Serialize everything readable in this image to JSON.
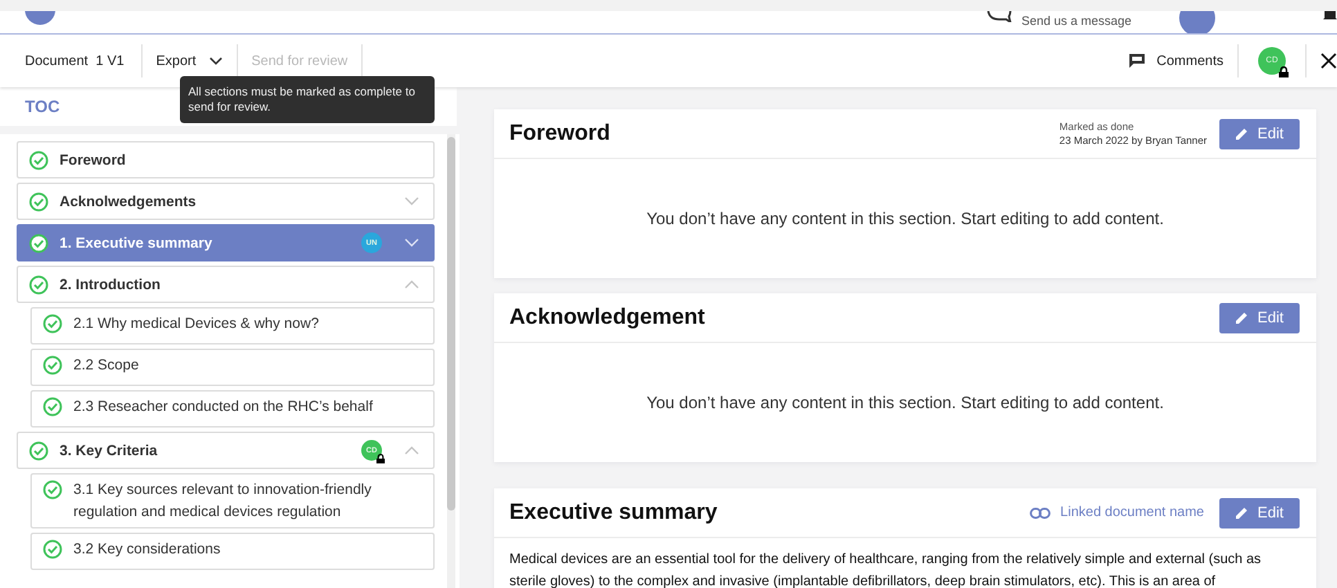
{
  "header": {
    "message_link": "Send us a message"
  },
  "toolbar": {
    "document": "Document  1 V1",
    "export": "Export",
    "send_review": {
      "label": "Send for review",
      "disabled": true
    },
    "comments": "Comments",
    "avatar": {
      "initials": "CD",
      "color": "#3fc35a",
      "locked": true
    }
  },
  "tooltip": "All sections must be marked as complete to send for review.",
  "toc": {
    "title": "TOC",
    "items": [
      {
        "label": "Foreword",
        "kind": "leaf",
        "selected": false,
        "done": true
      },
      {
        "label": "Acknolwedgements",
        "kind": "group",
        "selected": false,
        "done": true,
        "expanded": false
      },
      {
        "label": "1. Executive summary",
        "kind": "group",
        "selected": true,
        "done": true,
        "expanded": false,
        "avatar": {
          "initials": "UN",
          "color": "#2aa7dc",
          "locked": false
        }
      },
      {
        "label": "2. Introduction",
        "kind": "group",
        "selected": false,
        "done": true,
        "expanded": true,
        "children": [
          {
            "label": "2.1 Why medical Devices & why now?",
            "selected": false,
            "done": true
          },
          {
            "label": "2.2 Scope",
            "selected": false,
            "done": true
          },
          {
            "label": "2.3 Reseacher conducted on the RHC’s behalf",
            "selected": false,
            "done": true
          }
        ]
      },
      {
        "label": "3. Key Criteria",
        "kind": "group",
        "selected": false,
        "done": true,
        "expanded": true,
        "avatar": {
          "initials": "CD",
          "color": "#3fc35a",
          "locked": true
        },
        "children": [
          {
            "label": "3.1 Key sources relevant to innovation-friendly regulation and medical devices regulation",
            "selected": false,
            "done": true
          },
          {
            "label": "3.2 Key considerations",
            "selected": false,
            "done": true
          }
        ]
      }
    ]
  },
  "sections": [
    {
      "title": "Foreword",
      "status": [
        "Marked as done",
        "23 March 2022 by Bryan Tanner"
      ],
      "edit": "Edit",
      "kind": "empty",
      "body": "You don’t have any content in this section. Start editing to add content."
    },
    {
      "title": "Acknowledgement",
      "edit": "Edit",
      "kind": "empty",
      "body": "You don’t have any content in this section. Start editing to add content."
    },
    {
      "title": "Executive summary",
      "link": "Linked document name",
      "edit": "Edit",
      "kind": "text",
      "body": "Medical devices are an essential tool for the delivery of healthcare, ranging from the relatively simple and external (such as sterile gloves) to the complex and invasive (implantable defibrillators, deep brain stimulators, etc). This is an area of"
    }
  ]
}
